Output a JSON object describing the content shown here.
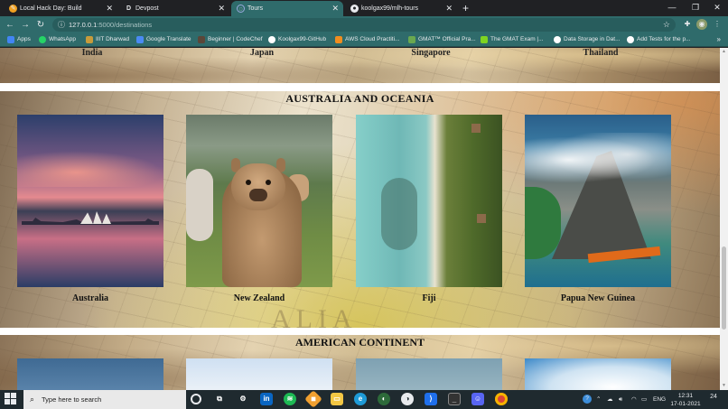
{
  "tabs": [
    {
      "title": "Local Hack Day: Build",
      "icon": "lhd-favicon-icon",
      "active": false
    },
    {
      "title": "Devpost",
      "icon": "devpost-favicon-icon",
      "active": false
    },
    {
      "title": "Tours",
      "icon": "globe-favicon-icon",
      "active": true
    },
    {
      "title": "koolgax99/mlh-tours",
      "icon": "github-favicon-icon",
      "active": false
    }
  ],
  "toolbar": {
    "url_host": "127.0.0.1",
    "url_path": ":5000/destinations"
  },
  "bookmarks": [
    {
      "label": "Apps",
      "color": "#4285f4"
    },
    {
      "label": "WhatsApp",
      "color": "#25d366"
    },
    {
      "label": "IIIT Dharwad",
      "color": "#c79b3b"
    },
    {
      "label": "Google Translate",
      "color": "#4a8af4"
    },
    {
      "label": "Beginner | CodeChef",
      "color": "#5b4638"
    },
    {
      "label": "Koolgax99-GitHub",
      "color": "#ffffff"
    },
    {
      "label": "AWS Cloud Practiti...",
      "color": "#f08d1f"
    },
    {
      "label": "GMAT™ Official Pra...",
      "color": "#6aa84f"
    },
    {
      "label": "The GMAT Exam |...",
      "color": "#7ed321"
    },
    {
      "label": "Data Storage in Dat...",
      "color": "#ffffff"
    },
    {
      "label": "Add Tests for the p...",
      "color": "#ffffff"
    }
  ],
  "top_row": {
    "labels": [
      "India",
      "Japan",
      "Singapore",
      "Thailand"
    ]
  },
  "region": {
    "title": "AUSTRALIA AND OCEANIA",
    "watermark": "ALIA",
    "cards": [
      {
        "label": "Australia"
      },
      {
        "label": "New Zealand"
      },
      {
        "label": "Fiji"
      },
      {
        "label": "Papua New Guinea"
      }
    ]
  },
  "next_region": {
    "title": "AMERICAN CONTINENT"
  },
  "taskbar": {
    "search_placeholder": "Type here to search",
    "lang": "ENG",
    "time": "12:31",
    "date": "17-01-2021",
    "notification_count": "24"
  }
}
